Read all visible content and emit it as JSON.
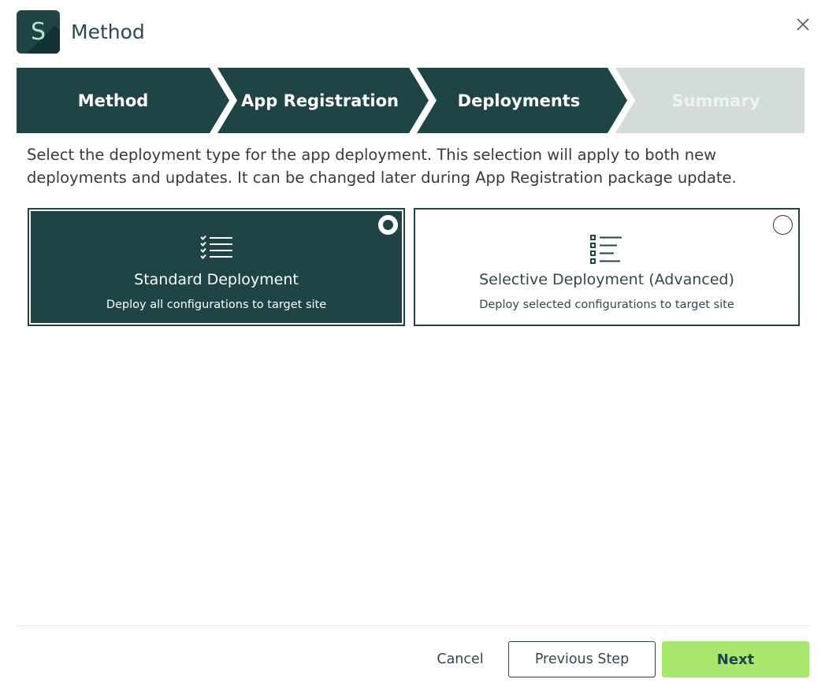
{
  "header": {
    "logo_letter": "S",
    "title": "Method"
  },
  "stepper": {
    "steps": [
      {
        "label": "Method",
        "state": "completed"
      },
      {
        "label": "App Registration",
        "state": "completed"
      },
      {
        "label": "Deployments",
        "state": "completed"
      },
      {
        "label": "Summary",
        "state": "upcoming"
      }
    ]
  },
  "description": "Select the deployment type for the app deployment. This selection will apply to both new deployments and updates. It can be changed later during App Registration package update.",
  "options": [
    {
      "title": "Standard Deployment",
      "subtitle": "Deploy all configurations to target site",
      "selected": true,
      "icon": "checklist-icon"
    },
    {
      "title": "Selective Deployment (Advanced)",
      "subtitle": "Deploy selected configurations to target site",
      "selected": false,
      "icon": "select-list-icon"
    }
  ],
  "footer": {
    "cancel_label": "Cancel",
    "previous_label": "Previous Step",
    "next_label": "Next"
  },
  "colors": {
    "primary": "#1f4446",
    "step_inactive": "#d4dcdb",
    "accent": "#a8e76e",
    "logo_text": "#b9e4c5"
  }
}
